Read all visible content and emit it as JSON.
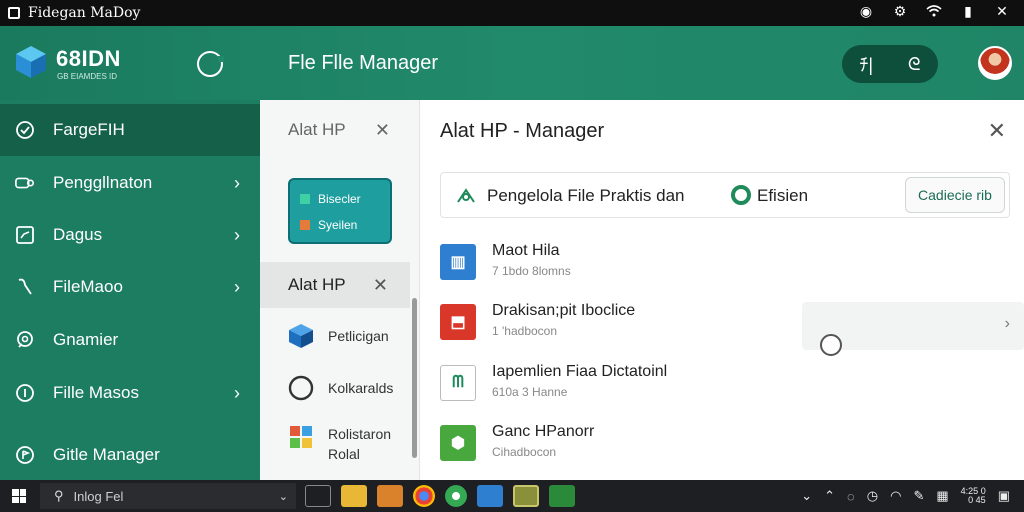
{
  "window": {
    "title": "Fidegan MaDoy"
  },
  "header": {
    "brand": "68IDN",
    "brand_sub": "GB EIAMDES ID",
    "title": "Fle Flle Manager",
    "pill_left": "ﾁ|",
    "pill_right": "ᘓ"
  },
  "sidebar": {
    "items": [
      {
        "label": "FargeFIH",
        "icon": "clock-icon",
        "chevron": ""
      },
      {
        "label": "Penggllnaton",
        "icon": "link-icon",
        "chevron": "›"
      },
      {
        "label": "Dagus",
        "icon": "chart-icon",
        "chevron": "›"
      },
      {
        "label": "FileMaoo",
        "icon": "file-icon",
        "chevron": "›"
      },
      {
        "label": "Gnamier",
        "icon": "globe-icon",
        "chevron": ""
      },
      {
        "label": "Fille Masos",
        "icon": "info-icon",
        "chevron": "›"
      },
      {
        "label": "Gitle Manager",
        "icon": "flag-icon",
        "chevron": ""
      }
    ]
  },
  "midcol": {
    "header": "Alat HP",
    "close": "✕",
    "card": {
      "row1": "Bisecler",
      "row2": "Syeilen"
    },
    "selected": "Alat HP",
    "items": [
      {
        "label": "Petlicigan",
        "icon": "cube-icon"
      },
      {
        "label": "Kolkaralds",
        "icon": "circle-icon"
      },
      {
        "label": "Rolistaron\nRolal",
        "icon": "puzzle-icon"
      }
    ]
  },
  "main": {
    "title": "Alat HP - Manager",
    "close": "✕",
    "banner": {
      "text": "Pengelola File Praktis dan",
      "text2": "Efisien",
      "button": "Cadiecie rib"
    },
    "files": [
      {
        "name": "Maot Hila",
        "meta": "7 1bdo 8lomns",
        "color": "#2f7fd0",
        "glyph": "▥"
      },
      {
        "name": "Drakisan;pit Iboclice",
        "meta": "1 'hadbocon",
        "color": "#d9372a",
        "glyph": "⬒"
      },
      {
        "name": "Iapemlien Fiaa Dictatoinl",
        "meta": "610a 3 Hanne",
        "color": "#ffffff",
        "glyph": "ᗰ"
      },
      {
        "name": "Ganc HPanorr",
        "meta": "Cihadbocon",
        "color": "#49a83d",
        "glyph": "⬢"
      }
    ],
    "detail_chevron": "›"
  },
  "taskbar": {
    "search": "Inlog Fel",
    "clock_top": "4:25 0",
    "clock_bottom": "0  45"
  },
  "colors": {
    "header": "#218a6a",
    "sidebar": "#1d7d60",
    "sidebar_active": "#146048",
    "accent_teal": "#1e9e9e"
  }
}
